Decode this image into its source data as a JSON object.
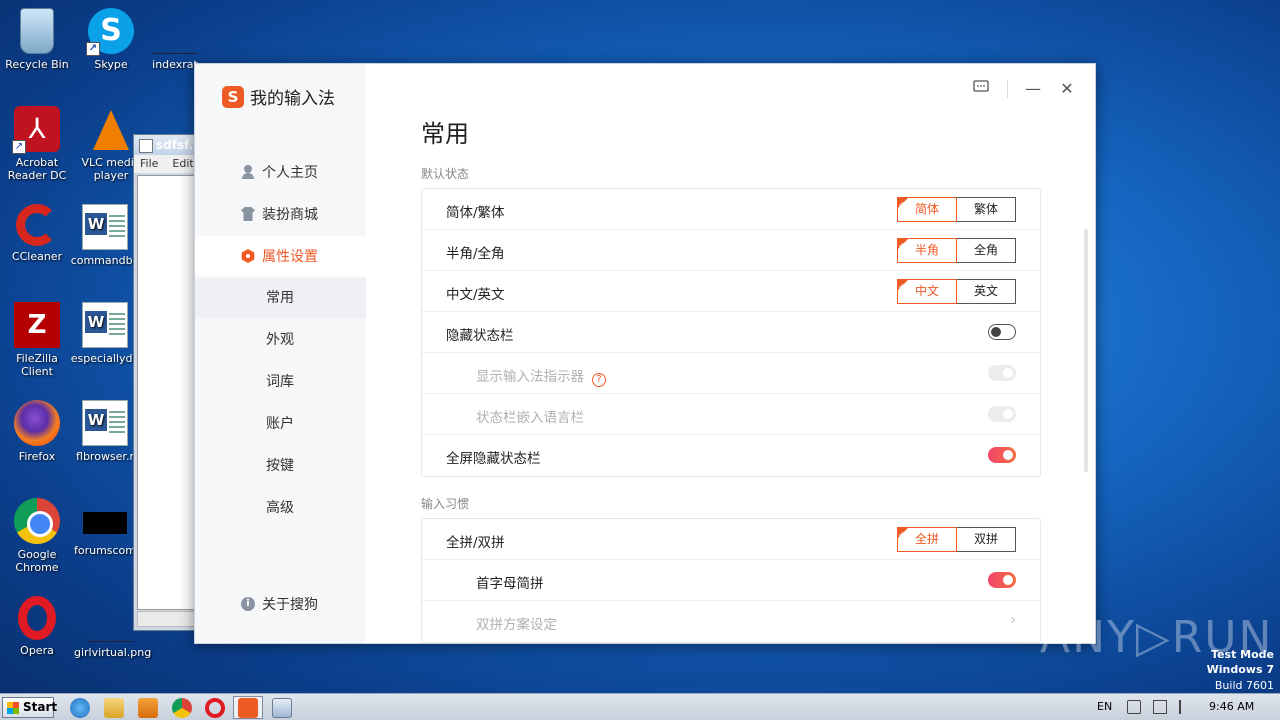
{
  "desktop": {
    "icons": [
      {
        "label": "Recycle Bin"
      },
      {
        "label": "Skype"
      },
      {
        "label": "indexrat"
      },
      {
        "label": "Acrobat Reader DC"
      },
      {
        "label": "VLC media player"
      },
      {
        "label": "CCleaner"
      },
      {
        "label": "commandbo"
      },
      {
        "label": "FileZilla Client"
      },
      {
        "label": "especiallyde"
      },
      {
        "label": "Firefox"
      },
      {
        "label": "flbrowser.r"
      },
      {
        "label": "Google Chrome"
      },
      {
        "label": "forumscom"
      },
      {
        "label": "Opera"
      },
      {
        "label": "girlvirtual.png"
      }
    ],
    "watermark": "ANY▷RUN",
    "os_info": {
      "line1": "Test Mode",
      "line2": "Windows 7",
      "line3": "Build 7601"
    }
  },
  "notepad": {
    "title": "sdfsf.tx",
    "menu": [
      "File",
      "Edit"
    ]
  },
  "ime": {
    "brand": "我的输入法",
    "brand_logo": "S",
    "nav": {
      "home": "个人主页",
      "store": "装扮商城",
      "settings": "属性设置",
      "sub": [
        "常用",
        "外观",
        "词库",
        "账户",
        "按键",
        "高级"
      ],
      "about": "关于搜狗"
    },
    "page_title": "常用",
    "section1": {
      "label": "默认状态",
      "rows": [
        {
          "label": "简体/繁体",
          "opt_on": "简体",
          "opt_off": "繁体"
        },
        {
          "label": "半角/全角",
          "opt_on": "半角",
          "opt_off": "全角"
        },
        {
          "label": "中文/英文",
          "opt_on": "中文",
          "opt_off": "英文"
        },
        {
          "label": "隐藏状态栏"
        },
        {
          "label": "显示输入法指示器"
        },
        {
          "label": "状态栏嵌入语言栏"
        },
        {
          "label": "全屏隐藏状态栏"
        }
      ]
    },
    "section2": {
      "label": "输入习惯",
      "rows": [
        {
          "label": "全拼/双拼",
          "opt_on": "全拼",
          "opt_off": "双拼"
        },
        {
          "label": "首字母简拼"
        },
        {
          "label": "双拼方案设定"
        }
      ]
    },
    "help_glyph": "?",
    "chevron": "›",
    "info_glyph": "i"
  },
  "taskbar": {
    "start": "Start",
    "lang": "EN",
    "time": "9:46 AM"
  },
  "colors": {
    "accent": "#ee5a24",
    "toggle_on_start": "#f2446b",
    "toggle_on_end": "#f2703f"
  }
}
